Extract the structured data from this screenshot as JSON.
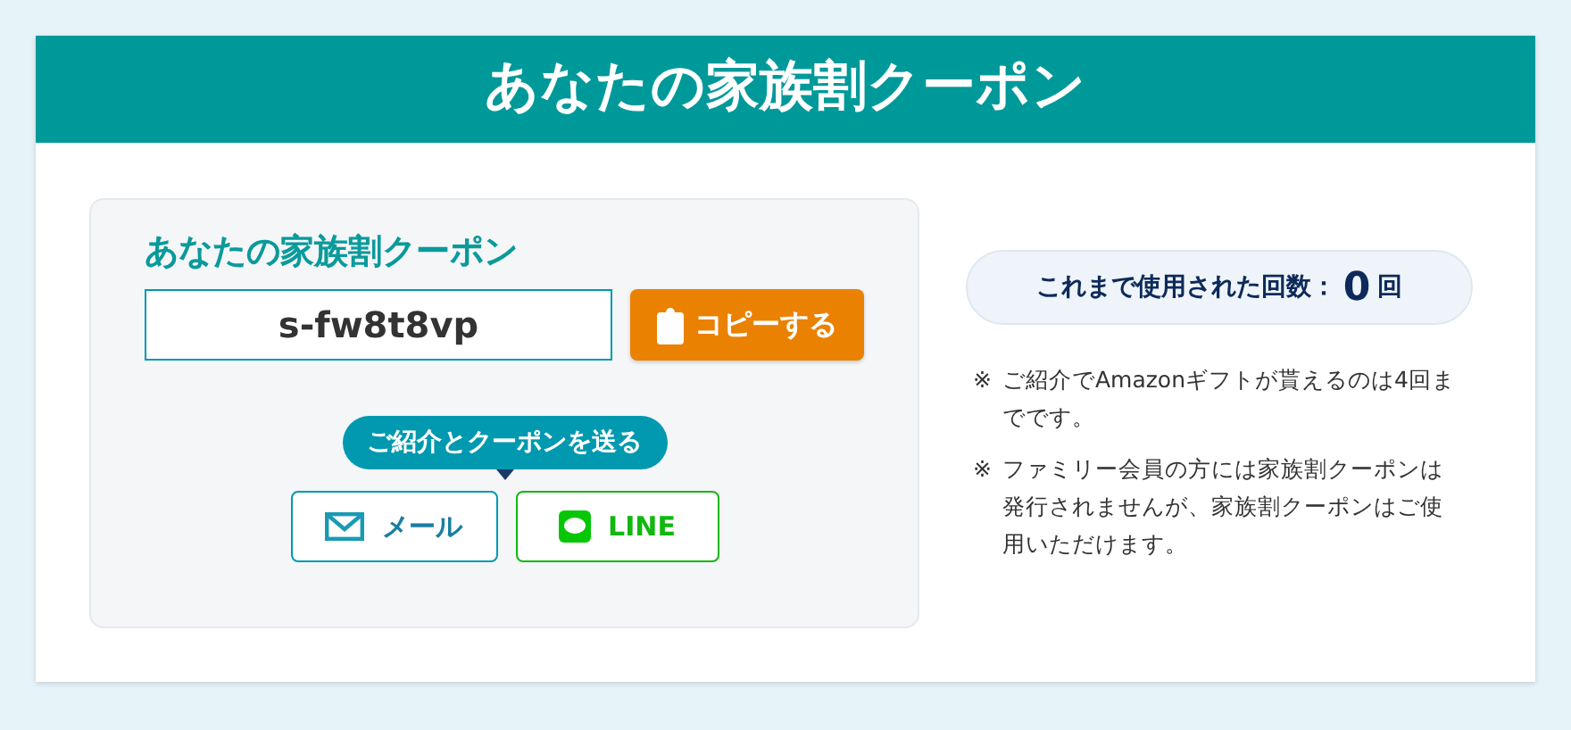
{
  "header": {
    "title": "あなたの家族割クーポン"
  },
  "coupon": {
    "heading": "あなたの家族割クーポン",
    "code": "s-fw8t8vp",
    "copy_button": "コピーする",
    "send_label": "ご紹介とクーポンを送る",
    "share_buttons": [
      {
        "kind": "mail",
        "label": "メール"
      },
      {
        "kind": "line",
        "label": "LINE"
      }
    ]
  },
  "usage": {
    "label": "これまで使用された回数：",
    "count": "0",
    "unit": "回"
  },
  "notes": [
    {
      "mark": "※",
      "text": "ご紹介でAmazonギフトが貰えるのは4回までです。"
    },
    {
      "mark": "※",
      "text": "ファミリー会員の方には家族割クーポンは発行されませんが、家族割クーポンはご使用いただけます。"
    }
  ]
}
